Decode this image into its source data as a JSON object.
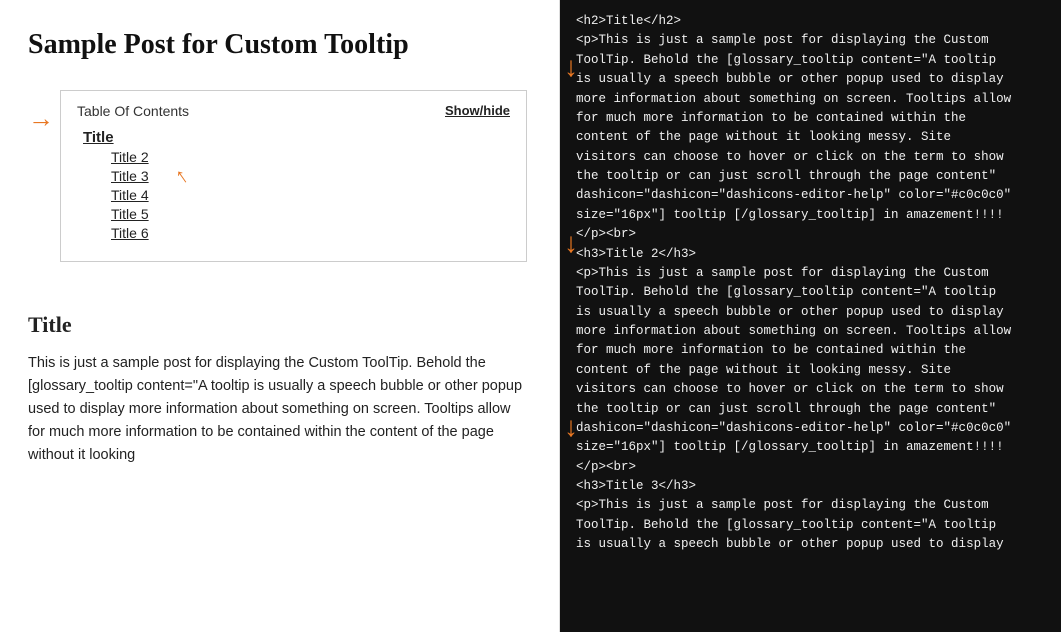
{
  "page": {
    "title": "Sample Post for Custom Tooltip",
    "toc": {
      "label": "Table Of Contents",
      "show_hide": "Show/hide",
      "items": [
        {
          "id": "title-1",
          "label": "Title",
          "level": 1
        },
        {
          "id": "title-2",
          "label": "Title 2",
          "level": 2
        },
        {
          "id": "title-3",
          "label": "Title 3",
          "level": 2
        },
        {
          "id": "title-4",
          "label": "Title 4",
          "level": 2
        },
        {
          "id": "title-5",
          "label": "Title 5",
          "level": 2
        },
        {
          "id": "title-6",
          "label": "Title 6",
          "level": 2
        }
      ]
    },
    "section_heading": "Title",
    "section_body": "This is just a sample post for displaying the Custom ToolTip. Behold the [glossary_tooltip content=\"A tooltip is usually a speech bubble or other popup used to display more information about something on screen. Tooltips allow for much more information to be contained within the content of the page without it looking",
    "section_body_end": "messy. Site visitors can choose to hover or click on the term to show"
  },
  "code_panel": {
    "content": "<h2>Title</h2>\n<p>This is just a sample post for displaying the Custom\nToolTip. Behold the [glossary_tooltip content=\"A tooltip\nis usually a speech bubble or other popup used to display\nmore information about something on screen. Tooltips allow\nfor much more information to be contained within the\ncontent of the page without it looking messy. Site\nvisitors can choose to hover or click on the term to show\nthe tooltip or can just scroll through the page content\"\ndashicon=\"dashicon=\"dashicons-editor-help\" color=\"#c0c0c0\"\nsize=\"16px\"] tooltip [/glossary_tooltip] in amazement!!!!\n</p><br>\n<h3>Title 2</h3>\n<p>This is just a sample post for displaying the Custom\nToolTip. Behold the [glossary_tooltip content=\"A tooltip\nis usually a speech bubble or other popup used to display\nmore information about something on screen. Tooltips allow\nfor much more information to be contained within the\ncontent of the page without it looking messy. Site\nvisitors can choose to hover or click on the term to show\nthe tooltip or can just scroll through the page content\"\ndashicon=\"dashicon=\"dashicons-editor-help\" color=\"#c0c0c0\"\nsize=\"16px\"] tooltip [/glossary_tooltip] in amazement!!!!\n</p><br>\n<h3>Title 3</h3>\n<p>This is just a sample post for displaying the Custom\nToolTip. Behold the [glossary_tooltip content=\"A tooltip\nis usually a speech bubble or other popup used to display"
  },
  "colors": {
    "orange": "#e87722",
    "bg_dark": "#111111",
    "text_dark": "#222222",
    "code_text": "#f0f0f0"
  }
}
